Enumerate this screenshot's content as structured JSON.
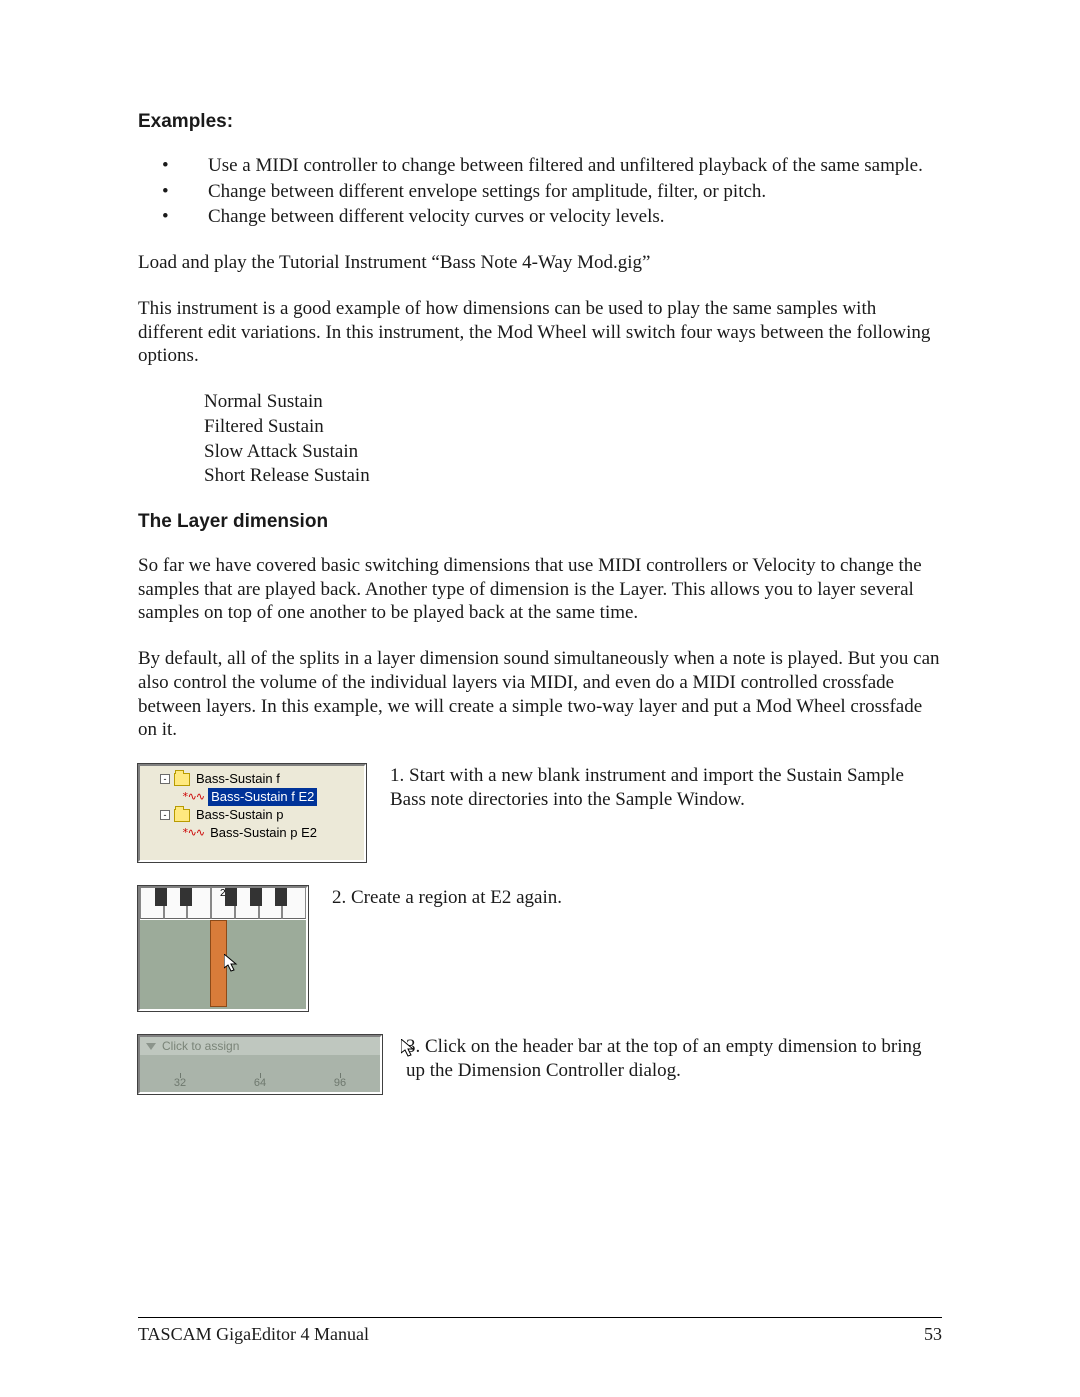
{
  "heading_examples": "Examples:",
  "bullets": [
    "Use a MIDI controller to change between filtered and unfiltered playback of the same sample.",
    "Change between different envelope settings for amplitude, filter, or pitch.",
    "Change between different velocity curves or velocity levels."
  ],
  "para_load": "Load and play the Tutorial Instrument “Bass Note 4-Way Mod.gig”",
  "para_good_example": "This instrument is a good example of how dimensions can be used to play the same samples with different edit variations.  In this instrument, the Mod Wheel will switch four ways between the following options.",
  "options": [
    "Normal Sustain",
    "Filtered Sustain",
    "Slow Attack Sustain",
    "Short Release Sustain"
  ],
  "heading_layer": "The Layer dimension",
  "para_layer1": "So far we have covered basic switching dimensions that use MIDI controllers or Velocity to change the samples that are played back.  Another type of dimension is the Layer.  This allows you to layer several samples on top of one another to be played back at the same time.",
  "para_layer2": "By default, all of the splits in a layer dimension sound simultaneously when a note is played.  But you can also control the volume of the individual layers via MIDI, and even do a MIDI controlled crossfade between layers.  In this example, we will create a simple two-way layer and put a Mod Wheel crossfade on it.",
  "tree": {
    "folder1": "Bass-Sustain f",
    "item1": "Bass-Sustain f E2",
    "folder2": "Bass-Sustain p",
    "item2": "Bass-Sustain p E2"
  },
  "step1": "1. Start with a new blank instrument and import the Sustain Sample Bass note directories into the Sample Window.",
  "kbd_note_number": "2",
  "step2": "2. Create a region at E2 again.",
  "assign_label": "Click to assign",
  "ruler_ticks": [
    "32",
    "64",
    "96"
  ],
  "step3": "3. Click on the header bar at the top of an empty dimension to bring up the Dimension Controller dialog.",
  "footer_left": "TASCAM GigaEditor 4 Manual",
  "footer_right": "53"
}
